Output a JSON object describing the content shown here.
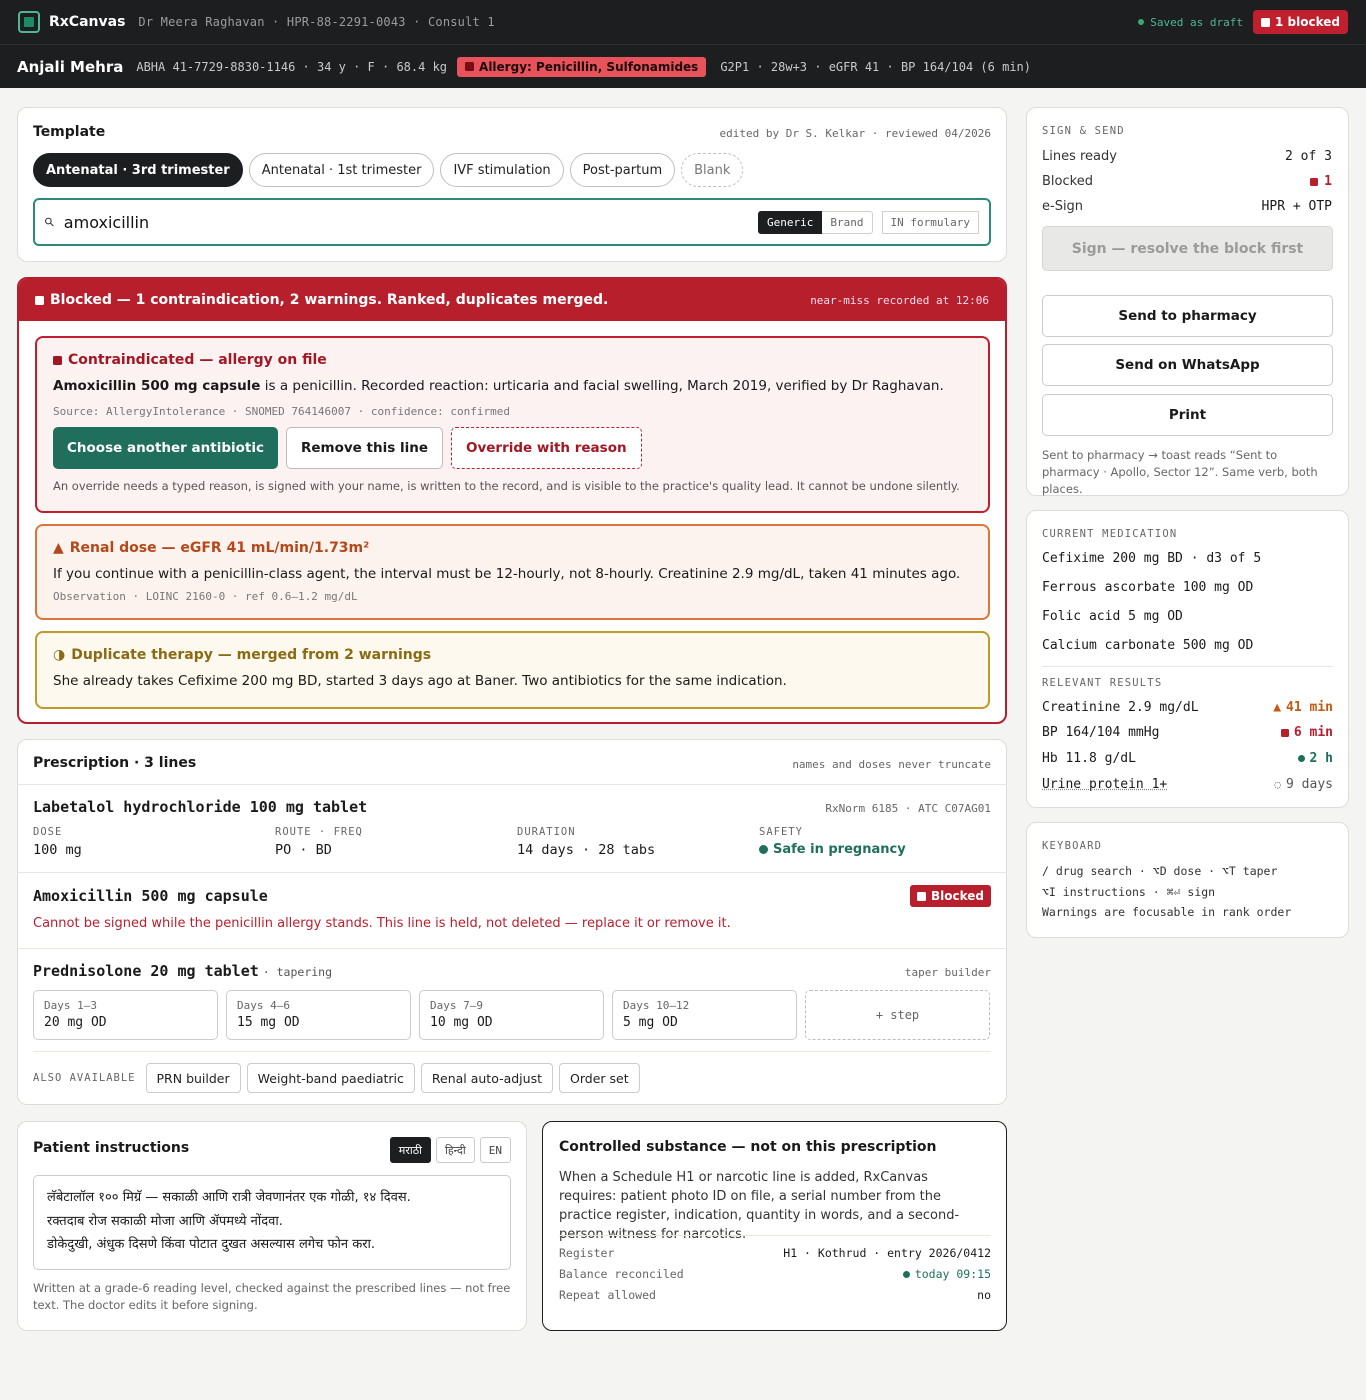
{
  "app": {
    "brand": "RxCanvas",
    "breadcrumb": "Dr Meera Raghavan · HPR-88-2291-0043 · Consult 1",
    "saved_status": "Saved as draft",
    "blocked_badge": "1 blocked"
  },
  "patient": {
    "name": "Anjali Mehra",
    "meta": "ABHA 41-7729-8830-1146 · 34 y · F · 68.4 kg",
    "allergy": "Allergy: Penicillin, Sulfonamides",
    "vitals": "G2P1 · 28w+3 · eGFR 41 · BP 164/104 (6 min)"
  },
  "template": {
    "title": "Template",
    "edited": "edited by Dr S. Kelkar · reviewed 04/2026",
    "chips": [
      "Antenatal · 3rd trimester",
      "Antenatal · 1st trimester",
      "IVF stimulation",
      "Post-partum",
      "Blank"
    ]
  },
  "search": {
    "value": "amoxicillin",
    "seg_generic": "Generic",
    "seg_brand": "Brand",
    "formulary": "IN formulary"
  },
  "alert": {
    "title": "Blocked — 1 contraindication, 2 warnings. Ranked, duplicates merged.",
    "recorded": "near-miss recorded at 12:06",
    "ci": {
      "title": "Contraindicated — allergy on file",
      "drug": "Amoxicillin 500 mg capsule",
      "text": " is a penicillin. Recorded reaction: urticaria and facial swelling, March 2019, verified by Dr Raghavan.",
      "source": "Source: AllergyIntolerance · SNOMED 764146007 · confidence: confirmed",
      "btn_choose": "Choose another antibiotic",
      "btn_remove": "Remove this line",
      "btn_override": "Override with reason",
      "note": "An override needs a typed reason, is signed with your name, is written to the record, and is visible to the practice's quality lead. It cannot be undone silently."
    },
    "renal": {
      "title": "Renal dose — eGFR 41 mL/min/1.73m²",
      "text": "If you continue with a penicillin-class agent, the interval must be 12-hourly, not 8-hourly. Creatinine 2.9 mg/dL, taken 41 minutes ago.",
      "source": "Observation · LOINC 2160-0 · ref 0.6–1.2 mg/dL"
    },
    "dup": {
      "title": "Duplicate therapy — merged from 2 warnings",
      "text": "She already takes Cefixime 200 mg BD, started 3 days ago at Baner. Two antibiotics for the same indication."
    }
  },
  "rx": {
    "title": "Prescription · 3 lines",
    "note": "names and doses never truncate",
    "labetalol": {
      "name": "Labetalol hydrochloride 100 mg tablet",
      "codes": "RxNorm 6185 · ATC C07AG01",
      "dose_label": "DOSE",
      "dose": "100 mg",
      "route_label": "ROUTE · FREQ",
      "route": "PO · BD",
      "duration_label": "DURATION",
      "duration": "14 days · 28 tabs",
      "safety_label": "SAFETY",
      "safety": "Safe in pregnancy"
    },
    "amox": {
      "name": "Amoxicillin 500 mg capsule",
      "tag": "Blocked",
      "message": "Cannot be signed while the penicillin allergy stands. This line is held, not deleted — replace it or remove it."
    },
    "pred": {
      "name": "Prednisolone 20 mg tablet",
      "sub": "· tapering",
      "builder": "taper builder",
      "steps": [
        {
          "days": "Days 1–3",
          "dose": "20 mg OD"
        },
        {
          "days": "Days 4–6",
          "dose": "15 mg OD"
        },
        {
          "days": "Days 7–9",
          "dose": "10 mg OD"
        },
        {
          "days": "Days 10–12",
          "dose": "5 mg OD"
        }
      ],
      "add_step": "+ step"
    },
    "also_label": "ALSO AVAILABLE",
    "also": [
      "PRN builder",
      "Weight-band paediatric",
      "Renal auto-adjust",
      "Order set"
    ]
  },
  "instructions": {
    "title": "Patient instructions",
    "langs": [
      "मराठी",
      "हिन्दी",
      "EN"
    ],
    "lines": [
      "लॅबेटालॉल १०० मिग्रॅ — सकाळी आणि रात्री जेवणानंतर एक गोळी, १४ दिवस.",
      "रक्तदाब रोज सकाळी मोजा आणि ॲपमध्ये नोंदवा.",
      "डोकेदुखी, अंधुक दिसणे किंवा पोटात दुखत असल्यास लगेच फोन करा."
    ],
    "footer": "Written at a grade-6 reading level, checked against the prescribed lines — not free text. The doctor edits it before signing."
  },
  "controlled": {
    "title": "Controlled substance — not on this prescription",
    "body": "When a Schedule H1 or narcotic line is added, RxCanvas requires: patient photo ID on file, a serial number from the practice register, indication, quantity in words, and a second-person witness for narcotics.",
    "register_label": "Register",
    "register": "H1 · Kothrud · entry 2026/0412",
    "balance_label": "Balance reconciled",
    "balance": "today 09:15",
    "repeat_label": "Repeat allowed",
    "repeat": "no"
  },
  "sign": {
    "label": "SIGN & SEND",
    "lines_ready_label": "Lines ready",
    "lines_ready": "2 of 3",
    "blocked_label": "Blocked",
    "blocked": "1",
    "esign_label": "e-Sign",
    "esign": "HPR + OTP",
    "sign_btn": "Sign — resolve the block first",
    "send_pharmacy": "Send to pharmacy",
    "send_whatsapp": "Send on WhatsApp",
    "print": "Print",
    "note": "Sent to pharmacy → toast reads “Sent to pharmacy · Apollo, Sector 12”. Same verb, both places."
  },
  "current_meds": {
    "label": "CURRENT MEDICATION",
    "items": [
      "Cefixime 200 mg BD · d3 of 5",
      "Ferrous ascorbate 100 mg OD",
      "Folic acid 5 mg OD",
      "Calcium carbonate 500 mg OD"
    ]
  },
  "results": {
    "label": "RELEVANT RESULTS",
    "items": [
      {
        "name": "Creatinine 2.9 mg/dL",
        "age": "41 min",
        "color": "#c25a14"
      },
      {
        "name": "BP 164/104 mmHg",
        "age": "6 min",
        "color": "#b81f2d"
      },
      {
        "name": "Hb 11.8 g/dL",
        "age": "2 h",
        "color": "#1f6f5c"
      },
      {
        "name": "Urine protein 1+",
        "age": "9 days",
        "color": "#555555"
      }
    ]
  },
  "keyboard": {
    "label": "KEYBOARD",
    "line1": "/ drug search · ⌥D dose · ⌥T taper",
    "line2": "⌥I instructions · ⌘⏎ sign",
    "line3": "Warnings are focusable in rank order"
  }
}
